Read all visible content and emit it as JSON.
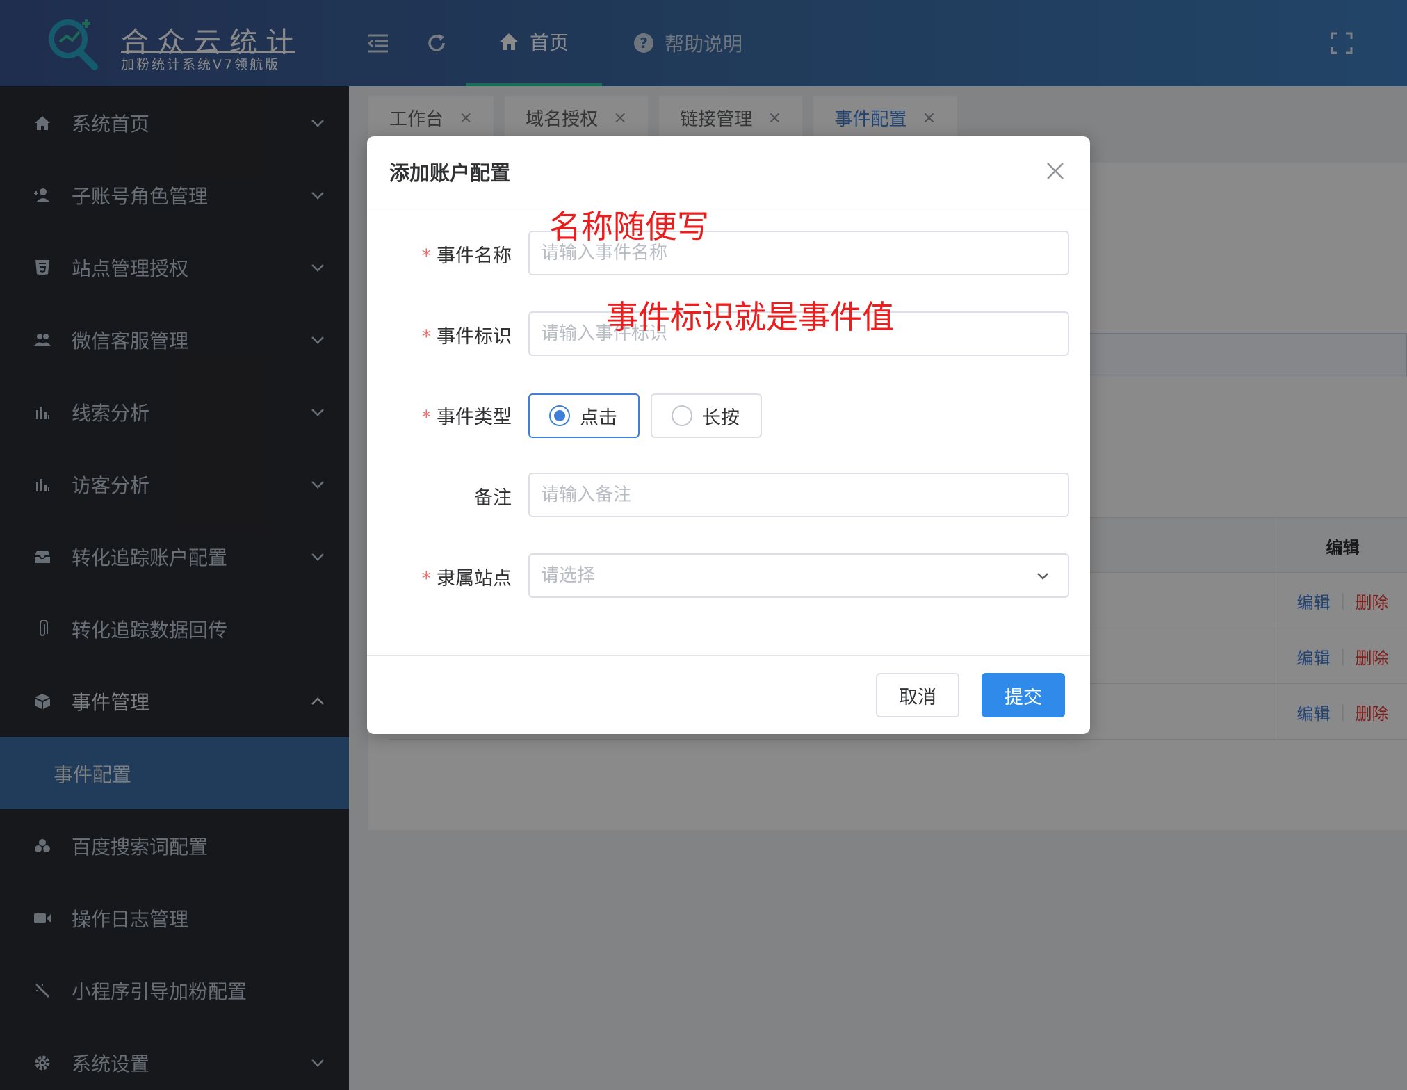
{
  "app": {
    "title": "合众云统计",
    "subtitle": "加粉统计系统V7领航版"
  },
  "header": {
    "nav_home": "首页",
    "nav_help": "帮助说明",
    "help_glyph": "?"
  },
  "sidebar": {
    "items": [
      {
        "label": "系统首页",
        "icon": "home-icon"
      },
      {
        "label": "子账号角色管理",
        "icon": "user-add-icon"
      },
      {
        "label": "站点管理授权",
        "icon": "html5-icon"
      },
      {
        "label": "微信客服管理",
        "icon": "users-icon"
      },
      {
        "label": "线索分析",
        "icon": "bar-chart-icon"
      },
      {
        "label": "访客分析",
        "icon": "bar-chart-icon"
      },
      {
        "label": "转化追踪账户配置",
        "icon": "inbox-icon"
      },
      {
        "label": "转化追踪数据回传",
        "icon": "paperclip-icon"
      },
      {
        "label": "事件管理",
        "icon": "cube-icon"
      },
      {
        "label": "百度搜索词配置",
        "icon": "circles-icon"
      },
      {
        "label": "操作日志管理",
        "icon": "video-icon"
      },
      {
        "label": "小程序引导加粉配置",
        "icon": "magic-icon"
      },
      {
        "label": "系统设置",
        "icon": "gear-icon"
      }
    ],
    "active_sub": "事件配置"
  },
  "tabs": [
    {
      "label": "工作台",
      "close": "×"
    },
    {
      "label": "域名授权",
      "close": "×"
    },
    {
      "label": "链接管理",
      "close": "×"
    },
    {
      "label": "事件配置",
      "close": "×"
    }
  ],
  "table": {
    "edit_header": "编辑",
    "rows": [
      {
        "edit": "编辑",
        "sep": "|",
        "delete": "删除"
      },
      {
        "edit": "编辑",
        "sep": "|",
        "delete": "删除"
      },
      {
        "edit": "编辑",
        "sep": "|",
        "delete": "删除"
      }
    ]
  },
  "dialog": {
    "title": "添加账户配置",
    "required_mark": "*",
    "fields": {
      "name": {
        "label": "事件名称",
        "placeholder": "请输入事件名称"
      },
      "identifier": {
        "label": "事件标识",
        "placeholder": "请输入事件标识"
      },
      "type": {
        "label": "事件类型",
        "options": [
          "点击",
          "长按"
        ],
        "selected": "点击"
      },
      "remark": {
        "label": "备注",
        "placeholder": "请输入备注"
      },
      "site": {
        "label": "隶属站点",
        "placeholder": "请选择"
      }
    },
    "cancel_label": "取消",
    "submit_label": "提交"
  },
  "annotations": {
    "name_hint": "名称随便写",
    "identifier_hint": "事件标识就是事件值"
  },
  "colors": {
    "header_start": "#3a5590",
    "header_end": "#3f7fc0",
    "sidebar_bg": "#2c2d32",
    "active_sub_bg": "#3d6ea8",
    "primary": "#2f8ae9",
    "annotation": "#ee1d1d",
    "delete": "#e53935"
  }
}
